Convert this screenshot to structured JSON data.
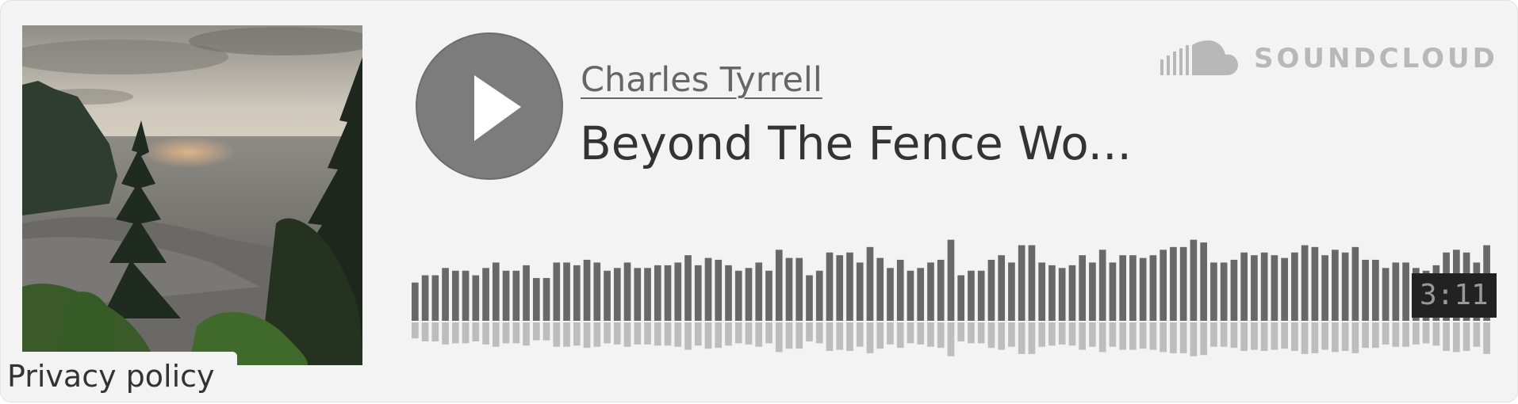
{
  "widget": {
    "artist": "Charles Tyrrell",
    "title": "Beyond The Fence Wo...",
    "duration": "3:11",
    "brand": "SOUNDCLOUD",
    "privacy_link": "Privacy policy",
    "play_icon": "play-icon",
    "brand_icon": "cloud-logo-icon"
  },
  "colors": {
    "background": "#f3f3f3",
    "play_button": "#7c7c7c",
    "waveform_top": "#686868",
    "waveform_bottom": "#bdbdbd",
    "brand": "#b8b8b8"
  },
  "waveform": {
    "played_fraction": 0,
    "bars": [
      0.42,
      0.5,
      0.5,
      0.58,
      0.55,
      0.55,
      0.5,
      0.58,
      0.64,
      0.55,
      0.55,
      0.61,
      0.47,
      0.47,
      0.64,
      0.64,
      0.61,
      0.67,
      0.64,
      0.55,
      0.58,
      0.64,
      0.58,
      0.58,
      0.61,
      0.61,
      0.64,
      0.72,
      0.61,
      0.69,
      0.67,
      0.61,
      0.55,
      0.58,
      0.64,
      0.55,
      0.78,
      0.69,
      0.69,
      0.5,
      0.55,
      0.75,
      0.72,
      0.75,
      0.64,
      0.81,
      0.69,
      0.58,
      0.67,
      0.55,
      0.58,
      0.64,
      0.67,
      0.89,
      0.5,
      0.55,
      0.55,
      0.67,
      0.72,
      0.64,
      0.83,
      0.83,
      0.64,
      0.61,
      0.58,
      0.61,
      0.72,
      0.64,
      0.78,
      0.64,
      0.72,
      0.72,
      0.69,
      0.72,
      0.78,
      0.81,
      0.81,
      0.89,
      0.86,
      0.64,
      0.64,
      0.67,
      0.75,
      0.72,
      0.75,
      0.72,
      0.69,
      0.75,
      0.83,
      0.81,
      0.72,
      0.78,
      0.75,
      0.81,
      0.67,
      0.67,
      0.58,
      0.64,
      0.64,
      0.58,
      0.55,
      0.61,
      0.75,
      0.78,
      0.75,
      0.64,
      0.83
    ]
  }
}
